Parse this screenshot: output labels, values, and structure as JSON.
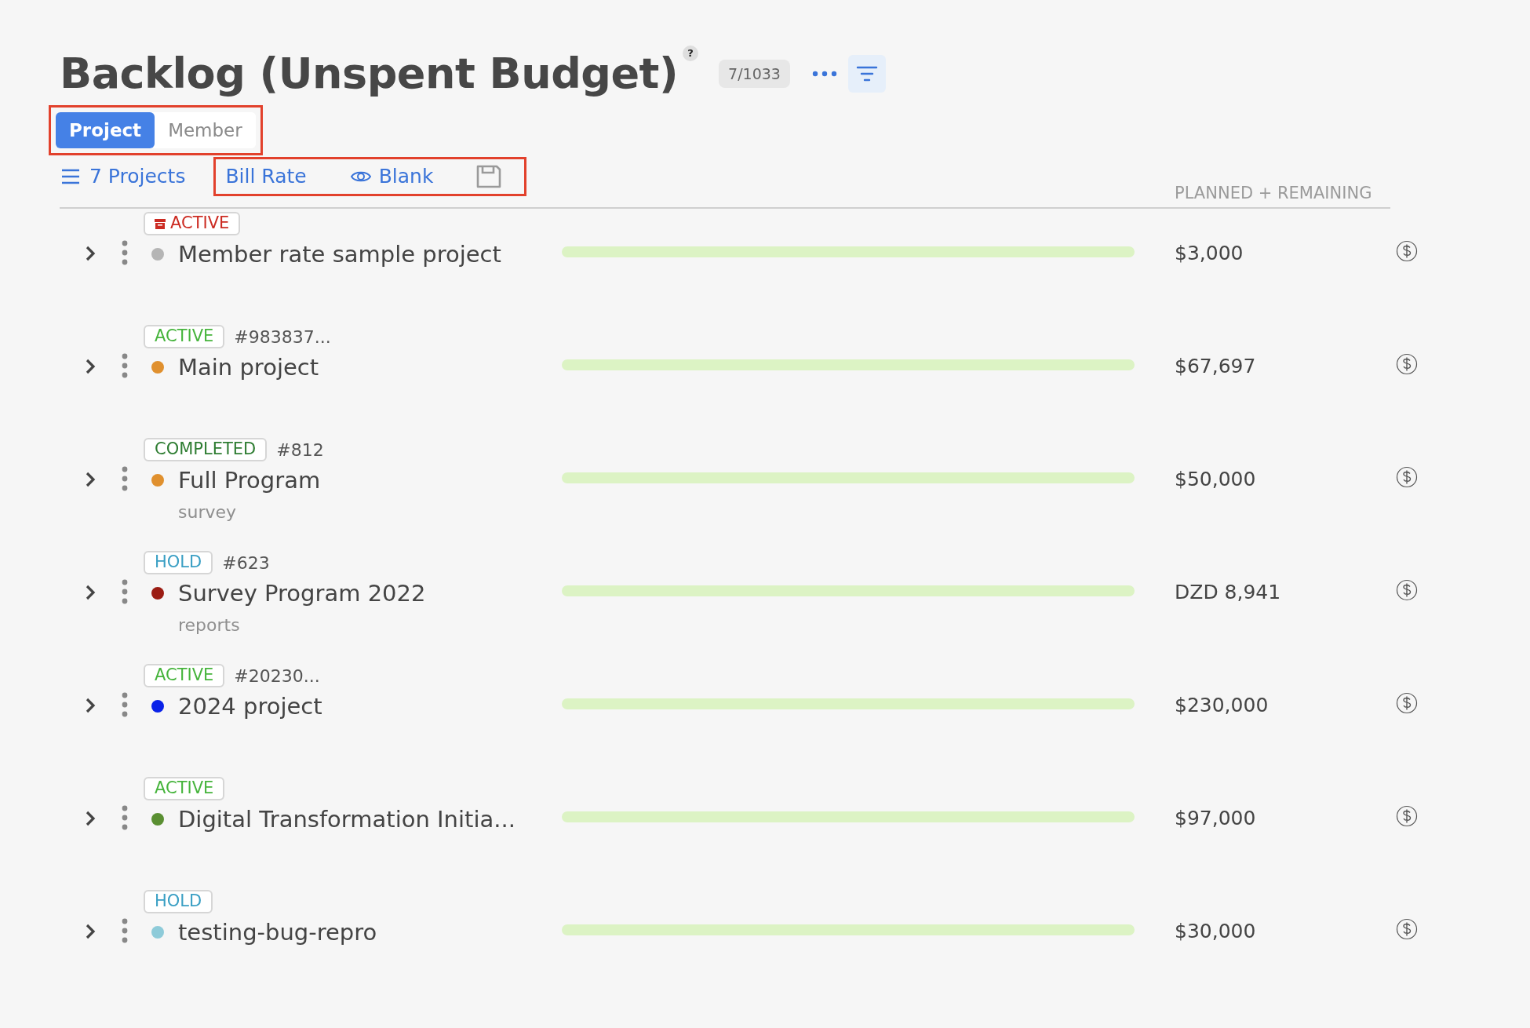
{
  "header": {
    "title": "Backlog (Unspent Budget)",
    "help": "?",
    "count": "7/1033"
  },
  "view_tabs": {
    "highlighted": true,
    "tabs": [
      {
        "label": "Project",
        "selected": true
      },
      {
        "label": "Member",
        "selected": false
      }
    ]
  },
  "toolbar": {
    "projects": "7 Projects",
    "highlighted": true,
    "bill_rate": "Bill Rate",
    "view": "Blank"
  },
  "column_header": "PLANNED + REMAINING",
  "rows": [
    {
      "tag": "ACTIVE",
      "kind": "archived",
      "id": "",
      "name": "Member rate sample project",
      "subtitle": "",
      "color": "#b5b5b5",
      "amount": "$3,000"
    },
    {
      "tag": "ACTIVE",
      "kind": "active",
      "id": "#983837...",
      "name": "Main project",
      "subtitle": "",
      "color": "#e0902e",
      "amount": "$67,697"
    },
    {
      "tag": "COMPLETED",
      "kind": "completed",
      "id": "#812",
      "name": "Full Program",
      "subtitle": "survey",
      "color": "#e0902e",
      "amount": "$50,000"
    },
    {
      "tag": "HOLD",
      "kind": "hold",
      "id": "#623",
      "name": "Survey Program 2022",
      "subtitle": "reports",
      "color": "#9b1c13",
      "amount": "DZD 8,941"
    },
    {
      "tag": "ACTIVE",
      "kind": "active",
      "id": "#20230...",
      "name": "2024 project",
      "subtitle": "",
      "color": "#0a22e8",
      "amount": "$230,000"
    },
    {
      "tag": "ACTIVE",
      "kind": "active",
      "id": "",
      "name": "Digital Transformation Initia...",
      "subtitle": "",
      "color": "#5a8f32",
      "amount": "$97,000"
    },
    {
      "tag": "HOLD",
      "kind": "hold",
      "id": "",
      "name": "testing-bug-repro",
      "subtitle": "",
      "color": "#8ecbd9",
      "amount": "$30,000"
    }
  ]
}
